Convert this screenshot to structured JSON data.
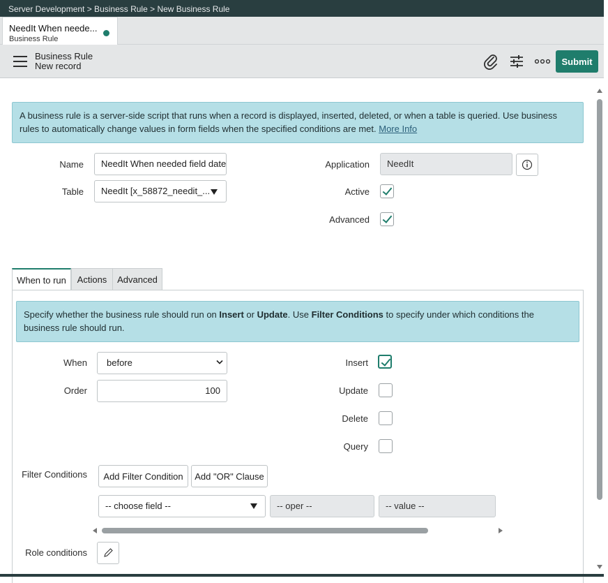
{
  "breadcrumb": "Server Development > Business Rule > New Business Rule",
  "doc_tab": {
    "title": "NeedIt When neede...",
    "subtitle": "Business Rule"
  },
  "header": {
    "title": "Business Rule",
    "subtitle": "New record",
    "submit_label": "Submit"
  },
  "info_banner": {
    "text": "A business rule is a server-side script that runs when a record is displayed, inserted, deleted, or when a table is queried. Use business rules to automatically change values in form fields when the specified conditions are met.",
    "link": "More Info"
  },
  "form": {
    "name_label": "Name",
    "name_value": "NeedIt When needed field date",
    "table_label": "Table",
    "table_value": "NeedIt [x_58872_needit_...",
    "application_label": "Application",
    "application_value": "NeedIt",
    "active_label": "Active",
    "active_checked": true,
    "advanced_label": "Advanced",
    "advanced_checked": true
  },
  "form_tabs": [
    "When to run",
    "Actions",
    "Advanced"
  ],
  "when_to_run": {
    "info_pre": "Specify whether the business rule should run on ",
    "info_insert": "Insert",
    "info_or": " or ",
    "info_update": "Update",
    "info_mid": ". Use ",
    "info_filter": "Filter Conditions",
    "info_post": " to specify under which conditions the business rule should run.",
    "when_label": "When",
    "when_value": "before",
    "when_options": [
      "before"
    ],
    "order_label": "Order",
    "order_value": "100",
    "insert_label": "Insert",
    "update_label": "Update",
    "delete_label": "Delete",
    "query_label": "Query",
    "filter_label": "Filter Conditions",
    "add_filter_label": "Add Filter Condition",
    "add_or_label": "Add \"OR\" Clause",
    "choose_field": "-- choose field --",
    "oper": "-- oper --",
    "value": "-- value --",
    "role_label": "Role conditions"
  },
  "checks": {
    "insert": true,
    "update": false,
    "delete": false,
    "query": false
  }
}
